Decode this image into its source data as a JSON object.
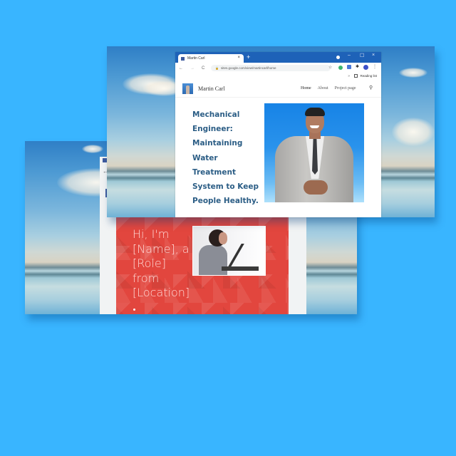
{
  "background_color": "#39b5ff",
  "front_browser": {
    "tab": {
      "title": "Martin Carl",
      "close_label": "×"
    },
    "new_tab_label": "+",
    "window_controls": {
      "minimize": "–",
      "maximize": "☐",
      "close": "×"
    },
    "nav": {
      "back": "←",
      "forward": "→",
      "reload": "C",
      "home": "⌂"
    },
    "address_bar": {
      "lock": "🔒",
      "url": "sites.google.com/view/martincarl/home"
    },
    "bookmark_star": "☆",
    "extensions_menu": "⋮",
    "puzzle": "✱",
    "bookmarks_bar": {
      "chevron": "»",
      "reading_list_label": "Reading list"
    },
    "site": {
      "name": "Martin Carl",
      "nav_items": [
        {
          "label": "Home",
          "active": true
        },
        {
          "label": "About",
          "active": false
        },
        {
          "label": "Project page",
          "active": false
        }
      ],
      "search_icon": "⚲",
      "headline_lines": [
        "Mechanical",
        "Engineer:",
        "Maintaining",
        "Water Treatment",
        "System to Keep",
        "People Healthy."
      ],
      "headline_color": "#2b5d85"
    }
  },
  "back_browser": {
    "nav_back": "←",
    "hero": {
      "lines": [
        "Hi, I'm",
        "[Name], a",
        "[Role]",
        "from",
        "[Location]"
      ],
      "background_color": "#e2463e"
    }
  }
}
